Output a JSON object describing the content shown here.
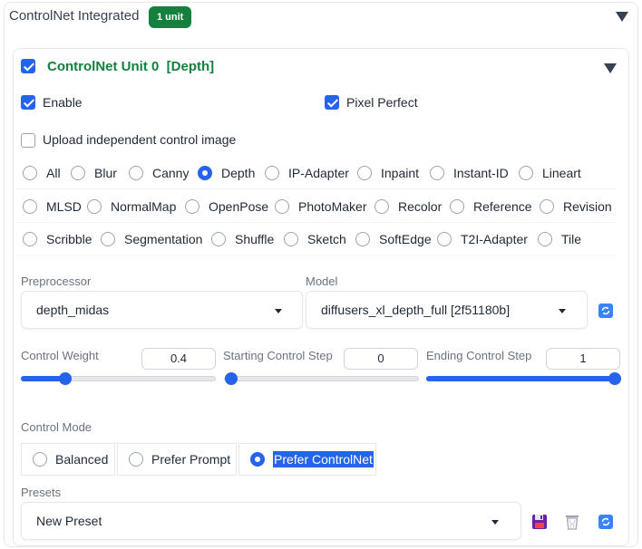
{
  "header": {
    "title": "ControlNet Integrated",
    "badge": "1 unit"
  },
  "unit": {
    "title": "ControlNet Unit 0",
    "type_tag": "[Depth]",
    "checked": true
  },
  "options": {
    "enable_label": "Enable",
    "enable_checked": true,
    "pixel_perfect_label": "Pixel Perfect",
    "pixel_perfect_checked": true,
    "upload_label": "Upload independent control image",
    "upload_checked": false
  },
  "control_types": {
    "selected": "Depth",
    "row1": [
      "All",
      "Blur",
      "Canny",
      "Depth",
      "IP-Adapter",
      "Inpaint",
      "Instant-ID",
      "Lineart"
    ],
    "row2": [
      "MLSD",
      "NormalMap",
      "OpenPose",
      "PhotoMaker",
      "Recolor",
      "Reference",
      "Revision"
    ],
    "row3": [
      "Scribble",
      "Segmentation",
      "Shuffle",
      "Sketch",
      "SoftEdge",
      "T2I-Adapter",
      "Tile"
    ]
  },
  "preprocessor": {
    "label": "Preprocessor",
    "value": "depth_midas"
  },
  "model": {
    "label": "Model",
    "value": "diffusers_xl_depth_full [2f51180b]"
  },
  "sliders": {
    "weight": {
      "label": "Control Weight",
      "value": "0.4",
      "fraction": 0.2
    },
    "start": {
      "label": "Starting Control Step",
      "value": "0",
      "fraction": 0.0
    },
    "end": {
      "label": "Ending Control Step",
      "value": "1",
      "fraction": 1.0
    }
  },
  "control_mode": {
    "label": "Control Mode",
    "options": [
      "Balanced",
      "Prefer Prompt",
      "Prefer ControlNet"
    ],
    "selected": "Prefer ControlNet"
  },
  "presets": {
    "label": "Presets",
    "value": "New Preset"
  },
  "icons": {
    "refresh": "refresh-icon",
    "save": "save-icon",
    "delete": "trash-icon",
    "collapse": "triangle-down-icon"
  },
  "colors": {
    "accent": "#2563eb",
    "brand_green": "#15803d"
  }
}
